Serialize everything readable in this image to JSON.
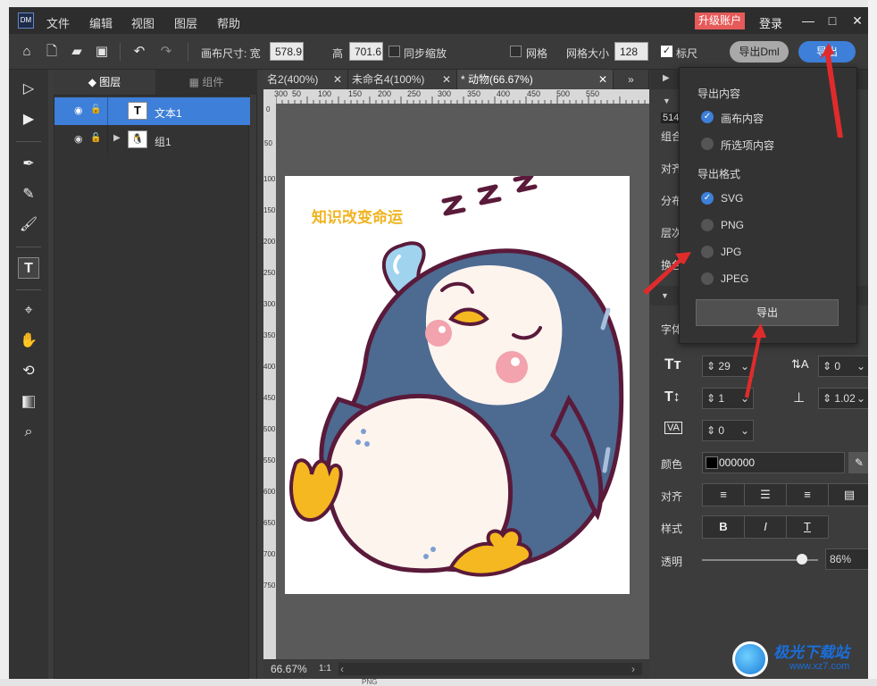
{
  "app": {
    "logo": "DM"
  },
  "menu": [
    "文件",
    "编辑",
    "视图",
    "图层",
    "帮助"
  ],
  "titlebar": {
    "upgrade": "升级账户",
    "login": "登录",
    "min": "—",
    "max": "□",
    "close": "✕"
  },
  "toolbar": {
    "canvas_size_label": "画布尺寸: 宽",
    "width": "578.9",
    "height_label": "高",
    "height": "701.6",
    "sync_scale": "同步缩放",
    "grid": "网格",
    "grid_size_label": "网格大小",
    "grid_size": "128",
    "ruler": "标尺",
    "export_dml": "导出Dml",
    "export": "导出"
  },
  "layers_panel": {
    "tab_layers": "图层",
    "tab_components": "组件",
    "items": [
      {
        "name": "文本1",
        "thumb": "T",
        "selected": true
      },
      {
        "name": "组1",
        "thumb": "🐧",
        "selected": false
      }
    ]
  },
  "doc_tabs": [
    "名2(400%)",
    "未命名4(100%)",
    "* 动物(66.67%)",
    "»"
  ],
  "ruler_h": [
    "300",
    "50",
    "100",
    "150",
    "200",
    "250",
    "300",
    "350",
    "400",
    "450",
    "500",
    "550"
  ],
  "ruler_v": [
    "0",
    "50",
    "100",
    "150",
    "200",
    "250",
    "300",
    "350",
    "400",
    "450",
    "500",
    "550",
    "600",
    "650",
    "700",
    "750"
  ],
  "canvas": {
    "text": "知识改变命运",
    "zzz": "Z Z Z"
  },
  "status": {
    "zoom": "66.67%",
    "ratio": "1:1"
  },
  "right_panel": {
    "partial_labels": [
      "514",
      "组合",
      "对齐",
      "分布",
      "层次",
      "换色",
      "字体"
    ],
    "font_size": "29",
    "letter_spacing": "0",
    "line_height": "1",
    "line_spacing": "1.02",
    "char_scale": "0",
    "color_label": "颜色",
    "color_value": "000000",
    "align_label": "对齐",
    "style_label": "样式",
    "opacity_label": "透明",
    "opacity_value": "86%",
    "opacity": 0.86
  },
  "export_dropdown": {
    "content_title": "导出内容",
    "content_options": [
      {
        "label": "画布内容",
        "checked": true
      },
      {
        "label": "所选项内容",
        "checked": false
      }
    ],
    "format_title": "导出格式",
    "format_options": [
      {
        "label": "SVG",
        "checked": true
      },
      {
        "label": "PNG",
        "checked": false
      },
      {
        "label": "JPG",
        "checked": false
      },
      {
        "label": "JPEG",
        "checked": false
      }
    ],
    "button": "导出"
  },
  "watermark": {
    "text": "极光下载站",
    "url": "www.xz7.com"
  },
  "bottom_strip": {
    "png_label": "PNG"
  },
  "colors": {
    "accent": "#3d7fd9",
    "upgrade": "#e65a5a",
    "title": "#f0b320",
    "penguin_body": "#4d6a91",
    "outline": "#5a1a3a",
    "feet": "#f5b820",
    "arrow": "#e02b2b"
  }
}
